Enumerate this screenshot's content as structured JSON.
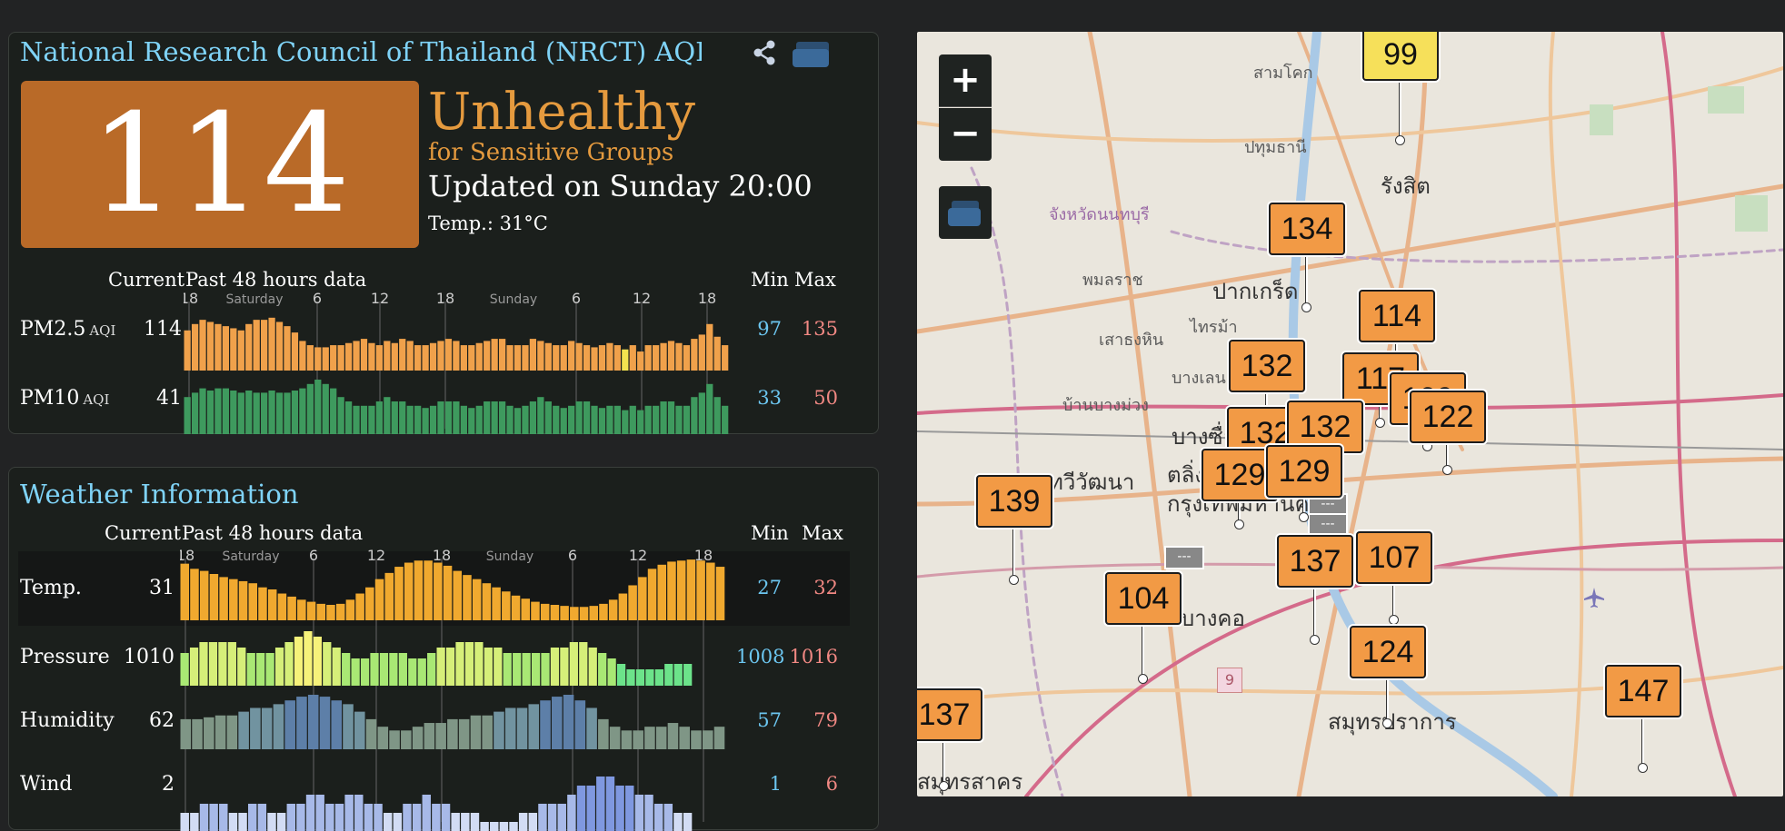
{
  "aqi": {
    "title": "National Research Council of Thailand (NRCT) AQI: N",
    "value": "114",
    "status": "Unhealthy",
    "status_sub": "for Sensitive Groups",
    "updated": "Updated on Sunday 20:00",
    "temp": "Temp.: 31°C",
    "colors": {
      "badge": "#b96a28",
      "status": "#e59a3e"
    },
    "headers": {
      "current": "Current",
      "past": "Past 48 hours data",
      "min": "Min",
      "max": "Max"
    },
    "ticks": [
      "18",
      "Saturday",
      "6",
      "12",
      "18",
      "Sunday",
      "6",
      "12",
      "18"
    ],
    "rows": [
      {
        "label": "PM2.5",
        "unit": "AQI",
        "current": "114",
        "min": "97",
        "max": "135",
        "color": "#f0a14b",
        "values": [
          118,
          124,
          128,
          126,
          124,
          122,
          120,
          118,
          124,
          128,
          128,
          130,
          126,
          122,
          116,
          108,
          104,
          102,
          102,
          104,
          104,
          106,
          108,
          110,
          106,
          104,
          108,
          106,
          110,
          108,
          104,
          104,
          106,
          108,
          110,
          108,
          104,
          104,
          106,
          108,
          110,
          110,
          104,
          104,
          104,
          110,
          108,
          106,
          104,
          104,
          108,
          106,
          104,
          102,
          104,
          106,
          104,
          100,
          104,
          98,
          104,
          104,
          106,
          108,
          106,
          104,
          110,
          114,
          124,
          112,
          104
        ]
      },
      {
        "label": "PM10",
        "unit": "AQI",
        "current": "41",
        "min": "33",
        "max": "50",
        "color": "#3e9a5e",
        "values": [
          42,
          44,
          46,
          45,
          46,
          46,
          45,
          44,
          45,
          44,
          44,
          45,
          44,
          44,
          45,
          46,
          48,
          50,
          48,
          46,
          42,
          40,
          38,
          38,
          38,
          40,
          42,
          40,
          40,
          38,
          38,
          37,
          38,
          40,
          40,
          40,
          38,
          37,
          38,
          40,
          40,
          40,
          38,
          37,
          38,
          40,
          42,
          40,
          38,
          37,
          38,
          40,
          40,
          38,
          37,
          38,
          38,
          36,
          38,
          36,
          38,
          38,
          40,
          40,
          38,
          38,
          42,
          44,
          48,
          42,
          38
        ]
      }
    ]
  },
  "weather": {
    "title": "Weather Information",
    "headers": {
      "current": "Current",
      "past": "Past 48 hours data",
      "min": "Min",
      "max": "Max"
    },
    "ticks": [
      "18",
      "Saturday",
      "6",
      "12",
      "18",
      "Sunday",
      "6",
      "12",
      "18"
    ],
    "rows": [
      {
        "label": "Temp.",
        "current": "31",
        "min": "27",
        "max": "32",
        "color": "#f0a92f",
        "values": [
          31.5,
          31,
          30.8,
          30.5,
          30.2,
          30,
          29.8,
          29.6,
          29.2,
          29,
          28.6,
          28.3,
          28,
          27.8,
          27.6,
          27.5,
          27.6,
          28,
          28.6,
          29.2,
          30,
          30.6,
          31.2,
          31.6,
          31.8,
          31.8,
          31.6,
          31.3,
          30.8,
          30.4,
          30,
          29.6,
          29.2,
          28.8,
          28.4,
          28.1,
          27.8,
          27.6,
          27.5,
          27.4,
          27.3,
          27.3,
          27.4,
          27.6,
          28,
          28.6,
          29.4,
          30.2,
          31,
          31.4,
          31.7,
          31.8,
          31.9,
          31.8,
          31.6,
          31.2
        ]
      },
      {
        "label": "Pressure",
        "current": "1010",
        "min": "1008",
        "max": "1016",
        "color": "#b8e86a",
        "values": [
          1012,
          1013,
          1014,
          1014,
          1014,
          1014,
          1013,
          1012,
          1012,
          1012,
          1013,
          1014,
          1015,
          1016,
          1015,
          1014,
          1013,
          1012,
          1011,
          1011,
          1012,
          1012,
          1012,
          1012,
          1011,
          1011,
          1012,
          1013,
          1013,
          1014,
          1014,
          1014,
          1013,
          1013,
          1012,
          1012,
          1012,
          1012,
          1012,
          1013,
          1013,
          1014,
          1014,
          1013,
          1012,
          1011,
          1010,
          1009,
          1009,
          1009,
          1009,
          1010,
          1010,
          1010
        ]
      },
      {
        "label": "Humidity",
        "current": "62",
        "min": "57",
        "max": "79",
        "color": "#7c8f88",
        "values": [
          66,
          66,
          67,
          68,
          68,
          70,
          72,
          72,
          74,
          76,
          78,
          79,
          78,
          76,
          74,
          70,
          66,
          62,
          60,
          60,
          62,
          64,
          64,
          66,
          66,
          68,
          68,
          70,
          72,
          72,
          74,
          76,
          78,
          79,
          76,
          72,
          66,
          62,
          60,
          60,
          62,
          62,
          64,
          62,
          60,
          60,
          62
        ]
      },
      {
        "label": "Wind",
        "current": "2",
        "min": "1",
        "max": "6",
        "color": "#a7b9e8",
        "values": [
          2,
          2,
          3,
          3,
          3,
          2,
          2,
          3,
          3,
          2,
          2,
          3,
          3,
          4,
          4,
          3,
          3,
          4,
          4,
          3,
          3,
          2,
          2,
          3,
          3,
          4,
          3,
          3,
          2,
          2,
          2,
          1,
          1,
          1,
          1,
          2,
          2,
          3,
          3,
          3,
          4,
          5,
          5,
          6,
          6,
          5,
          5,
          4,
          4,
          3,
          3,
          2,
          2
        ]
      }
    ]
  },
  "map": {
    "zoom_in": "+",
    "zoom_out": "−",
    "markers": [
      {
        "value": "99",
        "color": "#f6e05a"
      },
      {
        "value": "134",
        "color": "#f29a45"
      },
      {
        "value": "114",
        "color": "#f29a45"
      },
      {
        "value": "132",
        "color": "#f29a45"
      },
      {
        "value": "117",
        "color": "#f29a45"
      },
      {
        "value": "109",
        "color": "#f29a45"
      },
      {
        "value": "122",
        "color": "#f29a45"
      },
      {
        "value": "132",
        "color": "#f29a45"
      },
      {
        "value": "132",
        "color": "#f29a45"
      },
      {
        "value": "129",
        "color": "#f29a45"
      },
      {
        "value": "129",
        "color": "#f29a45"
      },
      {
        "value": "139",
        "color": "#f29a45"
      },
      {
        "value": "137",
        "color": "#f29a45"
      },
      {
        "value": "107",
        "color": "#f29a45"
      },
      {
        "value": "104",
        "color": "#f29a45"
      },
      {
        "value": "124",
        "color": "#f29a45"
      },
      {
        "value": "147",
        "color": "#f29a45"
      },
      {
        "value": "137",
        "color": "#f29a45"
      }
    ],
    "nodata_label": "---",
    "route_shield": "9",
    "labels": [
      "สามโคก",
      "ปทุมธานี",
      "รังสิต",
      "จังหวัดนนทบุรี",
      "พมลราช",
      "ปากเกร็ด",
      "ไทรม้า",
      "เสาธงหิน",
      "บางเลน",
      "บ้านบางม่วง",
      "บางซื่อ",
      "ทวีวัฒนา",
      "ตลิ่ง",
      "กรุงเทพมหานคร",
      "บางคอ",
      "สมุทรปราการ",
      "สมุทรสาคร"
    ]
  }
}
